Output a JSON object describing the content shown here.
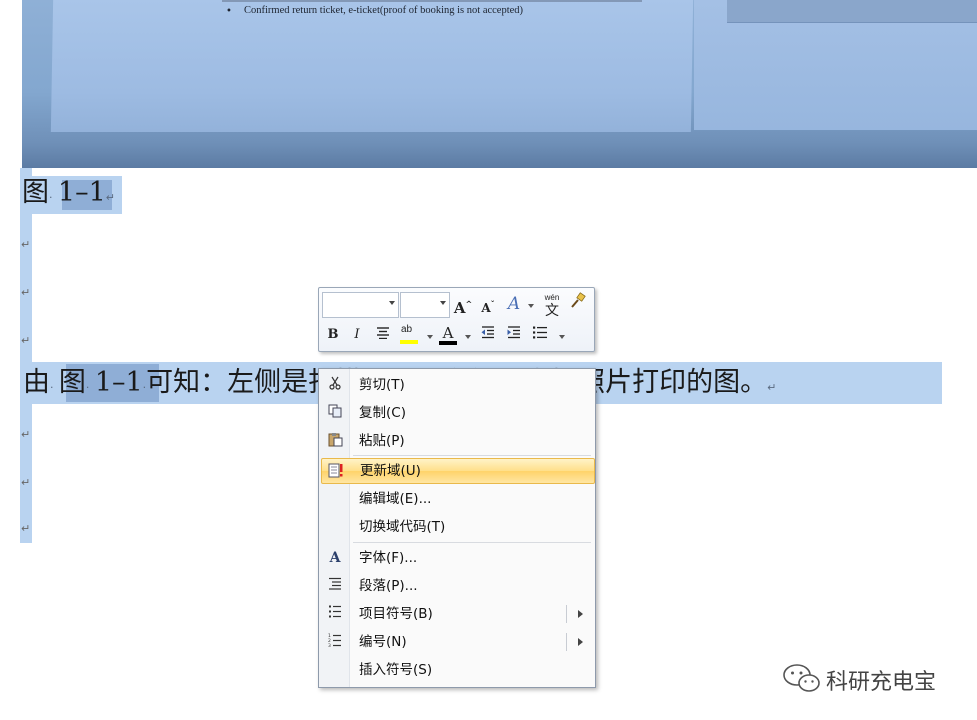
{
  "document": {
    "photo_bullet": "•",
    "photo_line": "Confirmed return ticket, e-ticket(proof of booking is not accepted)",
    "caption": {
      "prefix": "图",
      "number": "1–1"
    },
    "paragraph_mark": "↵",
    "body": {
      "before_field": "由",
      "field_prefix": "图",
      "field_number": "1–1",
      "after_field": "可知：左侧是扫描和图，右侧是直接照片打印的图。"
    }
  },
  "mini_toolbar": {
    "grow_font": "A",
    "shrink_font": "A",
    "styles": "A",
    "phonetic": "wén",
    "phonetic_char": "文",
    "bold": "B",
    "italic": "I",
    "font_color_letter": "A",
    "highlight_letter": "ab",
    "colors": {
      "highlight": "#ffff00",
      "font_color": "#000000",
      "styles_accent": "#4a6fb5"
    }
  },
  "context_menu": {
    "items": [
      {
        "label": "剪切(T)",
        "icon": "scissors-icon"
      },
      {
        "label": "复制(C)",
        "icon": "copy-icon"
      },
      {
        "label": "粘贴(P)",
        "icon": "paste-icon"
      },
      {
        "label": "更新域(U)",
        "icon": "update-field-icon",
        "highlighted": true
      },
      {
        "label": "编辑域(E)...",
        "icon": null
      },
      {
        "label": "切换域代码(T)",
        "icon": null
      },
      {
        "label": "字体(F)...",
        "icon": "font-icon"
      },
      {
        "label": "段落(P)...",
        "icon": "paragraph-icon"
      },
      {
        "label": "项目符号(B)",
        "icon": "bullets-icon",
        "submenu": true
      },
      {
        "label": "编号(N)",
        "icon": "numbering-icon",
        "submenu": true
      },
      {
        "label": "插入符号(S)",
        "icon": null
      }
    ]
  },
  "watermark": {
    "text": "科研充电宝",
    "icon": "wechat-icon"
  }
}
